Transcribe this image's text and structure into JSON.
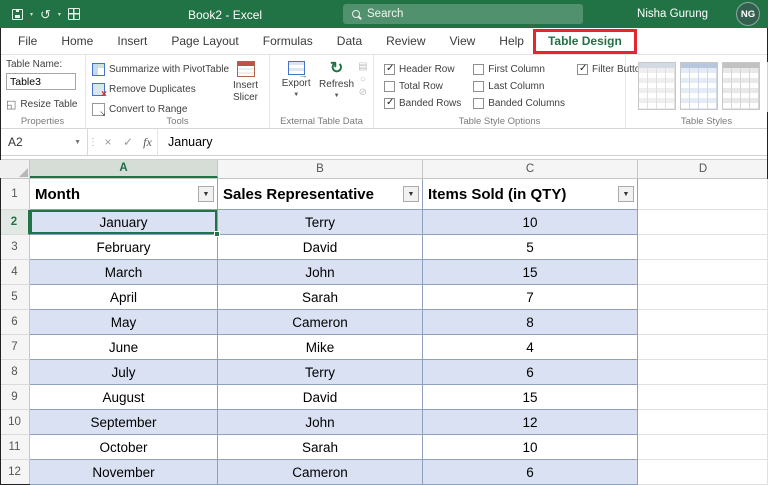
{
  "colors": {
    "titlebar": "#217346",
    "accent": "#217346",
    "banded_row": "#d9e1f2",
    "annotation": "#e8252c",
    "table_border": "#8ea0be"
  },
  "titlebar": {
    "title": "Book2 -  Excel",
    "search_label": "Search",
    "user_name": "Nisha Gurung",
    "user_initials": "NG"
  },
  "tabs": {
    "items": [
      {
        "label": "File",
        "active": false
      },
      {
        "label": "Home",
        "active": false
      },
      {
        "label": "Insert",
        "active": false
      },
      {
        "label": "Page Layout",
        "active": false
      },
      {
        "label": "Formulas",
        "active": false
      },
      {
        "label": "Data",
        "active": false
      },
      {
        "label": "Review",
        "active": false
      },
      {
        "label": "View",
        "active": false
      },
      {
        "label": "Help",
        "active": false
      },
      {
        "label": "Table Design",
        "active": true
      }
    ]
  },
  "ribbon": {
    "properties": {
      "group_label": "Properties",
      "table_name_label": "Table Name:",
      "table_name_value": "Table3",
      "resize_table_label": "Resize Table"
    },
    "tools": {
      "group_label": "Tools",
      "summarize_label": "Summarize with PivotTable",
      "remove_duplicates_label": "Remove Duplicates",
      "convert_label": "Convert to Range",
      "insert_slicer_label": "Insert Slicer"
    },
    "external": {
      "group_label": "External Table Data",
      "export_label": "Export",
      "refresh_label": "Refresh"
    },
    "style_options": {
      "group_label": "Table Style Options",
      "options": [
        {
          "label": "Header Row",
          "checked": true
        },
        {
          "label": "Total Row",
          "checked": false
        },
        {
          "label": "Banded Rows",
          "checked": true
        },
        {
          "label": "First Column",
          "checked": false
        },
        {
          "label": "Last Column",
          "checked": false
        },
        {
          "label": "Banded Columns",
          "checked": false
        },
        {
          "label": "Filter Button",
          "checked": true
        }
      ]
    },
    "table_styles": {
      "group_label": "Table Styles"
    }
  },
  "formula_bar": {
    "name_box_value": "A2",
    "fx_label": "fx",
    "content": "January"
  },
  "grid": {
    "column_headers": [
      "A",
      "B",
      "C",
      "D"
    ],
    "header_row_number": "1",
    "selected": {
      "cell": "A2",
      "row_index": 0,
      "col_index": 0
    },
    "table": {
      "headers": [
        "Month",
        "Sales Representative",
        "Items Sold (in QTY)"
      ],
      "rows": [
        [
          "January",
          "Terry",
          "10"
        ],
        [
          "February",
          "David",
          "5"
        ],
        [
          "March",
          "John",
          "15"
        ],
        [
          "April",
          "Sarah",
          "7"
        ],
        [
          "May",
          "Cameron",
          "8"
        ],
        [
          "June",
          "Mike",
          "4"
        ],
        [
          "July",
          "Terry",
          "6"
        ],
        [
          "August",
          "David",
          "15"
        ],
        [
          "September",
          "John",
          "12"
        ],
        [
          "October",
          "Sarah",
          "10"
        ],
        [
          "November",
          "Cameron",
          "6"
        ]
      ]
    }
  }
}
